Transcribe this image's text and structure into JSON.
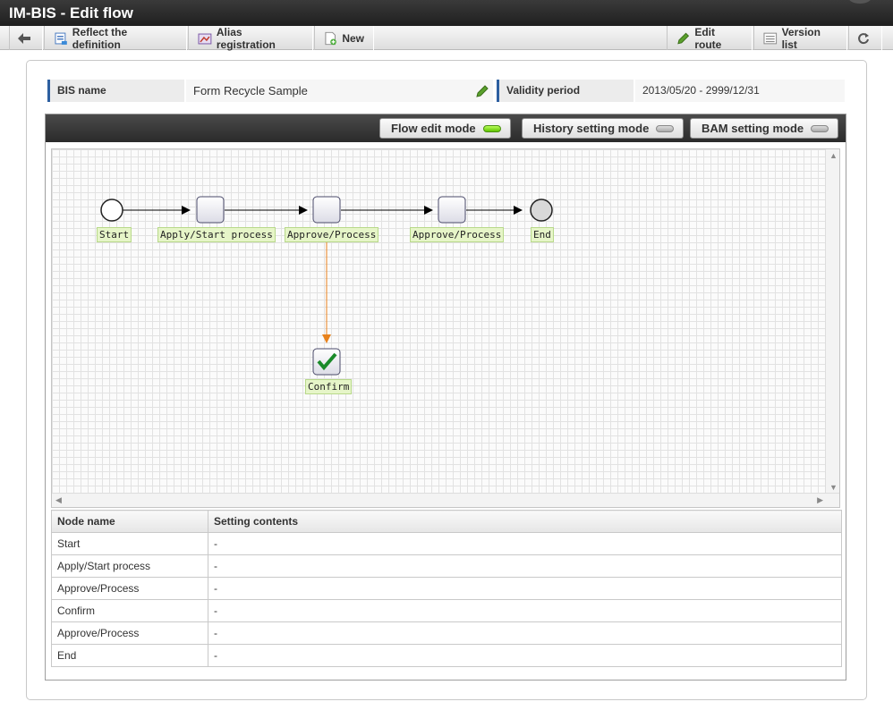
{
  "window": {
    "title": "IM-BIS - Edit flow"
  },
  "toolbar": {
    "back_icon": "arrow-left-icon",
    "reflect_label": "Reflect the definition",
    "alias_label": "Alias registration",
    "new_label": "New",
    "edit_route_label": "Edit route",
    "version_list_label": "Version list",
    "refresh_icon": "refresh-icon"
  },
  "info": {
    "bis_name_label": "BIS name",
    "bis_name_value": "Form Recycle Sample",
    "validity_label": "Validity period",
    "validity_value": "2013/05/20 - 2999/12/31"
  },
  "modes": {
    "flow_edit": "Flow edit mode",
    "history_setting": "History setting mode",
    "bam_setting": "BAM setting mode",
    "active": "flow_edit"
  },
  "flow": {
    "nodes": [
      {
        "label": "Start"
      },
      {
        "label": "Apply/Start process"
      },
      {
        "label": "Approve/Process"
      },
      {
        "label": "Approve/Process"
      },
      {
        "label": "End"
      },
      {
        "label": "Confirm"
      }
    ]
  },
  "table": {
    "headers": [
      "Node name",
      "Setting contents"
    ],
    "rows": [
      [
        "Start",
        "-"
      ],
      [
        "Apply/Start process",
        "-"
      ],
      [
        "Approve/Process",
        "-"
      ],
      [
        "Confirm",
        "-"
      ],
      [
        "Approve/Process",
        "-"
      ],
      [
        "End",
        "-"
      ]
    ]
  },
  "colors": {
    "accent": "#2d5fa0",
    "branch_line": "#e8821c",
    "active_led": "#6fd000",
    "node_label_bg": "#e6f5c8"
  }
}
